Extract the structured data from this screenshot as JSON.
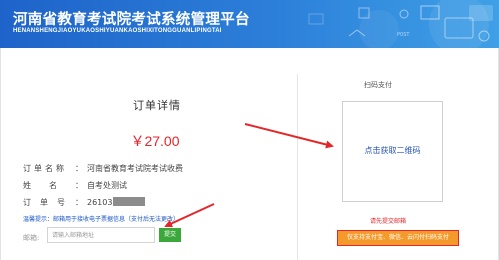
{
  "header": {
    "title": "河南省教育考试院考试系统管理平台",
    "subtitle": "HENANSHENGJIAOYUKAOSHIYUANKAOSHIXITONGGUANLIPINGTAI",
    "bg_color": "#2c7fd9"
  },
  "order": {
    "title": "订单详情",
    "amount": "￥27.00",
    "fields": [
      {
        "label": "订单名称",
        "value": "河南省教育考试院考试收费"
      },
      {
        "label": "姓名",
        "value": "自考处测试"
      },
      {
        "label": "订单号",
        "value": "26103"
      }
    ],
    "hint": "温馨提示：邮箱用于接收电子票据信息（支付后无法更改）",
    "email": {
      "label": "邮箱:",
      "placeholder": "请输入邮箱地址",
      "value": ""
    },
    "submit_label": "提交"
  },
  "payment": {
    "title": "扫码支付",
    "qr_link": "点击获取二维码",
    "select_email": "请先提交邮箱",
    "methods": "仅支持支付宝、微信、云闪付扫码支付",
    "accent_color": "#e4262a",
    "link_color": "#2351b8"
  },
  "annotations": {
    "arrow_color": "#e4262a",
    "arrow_count": 2
  }
}
